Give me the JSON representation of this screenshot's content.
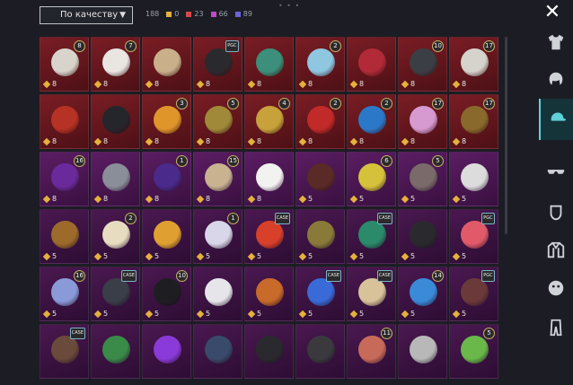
{
  "sort": {
    "label": "По качеству"
  },
  "counts": [
    {
      "value": "188",
      "color": "#9aa0a8"
    },
    {
      "value": "0",
      "color": "#e3b23c"
    },
    {
      "value": "23",
      "color": "#d84848"
    },
    {
      "value": "66",
      "color": "#c04ac8"
    },
    {
      "value": "89",
      "color": "#6b63d8"
    }
  ],
  "close_label": "✕",
  "rows": [
    {
      "rarity": "red",
      "items": [
        {
          "price": "8",
          "badge": "8",
          "art": "#d8d4cc"
        },
        {
          "price": "8",
          "badge": "7",
          "art": "#e9e6e2"
        },
        {
          "price": "8",
          "badge": "",
          "art": "#c9b08a"
        },
        {
          "price": "8",
          "badge": "PGC",
          "art": "#2a2a2e"
        },
        {
          "price": "8",
          "badge": "",
          "art": "#3c8f7a"
        },
        {
          "price": "8",
          "badge": "2",
          "art": "#8fc6e0"
        },
        {
          "price": "8",
          "badge": "",
          "art": "#b22a38"
        },
        {
          "price": "8",
          "badge": "10",
          "art": "#3b3e45"
        },
        {
          "price": "8",
          "badge": "17",
          "art": "#d6d2cc"
        }
      ]
    },
    {
      "rarity": "red",
      "items": [
        {
          "price": "8",
          "badge": "",
          "art": "#b63224"
        },
        {
          "price": "8",
          "badge": "",
          "art": "#24262c"
        },
        {
          "price": "8",
          "badge": "3",
          "art": "#e0952a"
        },
        {
          "price": "8",
          "badge": "5",
          "art": "#a08a3a"
        },
        {
          "price": "8",
          "badge": "4",
          "art": "#c7a23a"
        },
        {
          "price": "8",
          "badge": "2",
          "art": "#c22a2a"
        },
        {
          "price": "8",
          "badge": "2",
          "art": "#2c78c8"
        },
        {
          "price": "8",
          "badge": "17",
          "art": "#d69ad0"
        },
        {
          "price": "8",
          "badge": "17",
          "art": "#8a6a2c"
        }
      ]
    },
    {
      "rarity": "purple",
      "items": [
        {
          "price": "8",
          "badge": "16",
          "art": "#6a2a9c"
        },
        {
          "price": "8",
          "badge": "",
          "art": "#8a8e98"
        },
        {
          "price": "8",
          "badge": "1",
          "art": "#4a2a8a"
        },
        {
          "price": "8",
          "badge": "15",
          "art": "#c8b290"
        },
        {
          "price": "8",
          "badge": "",
          "art": "#f2f2f0"
        },
        {
          "price": "5",
          "badge": "",
          "art": "#5a2a26"
        },
        {
          "price": "5",
          "badge": "6",
          "art": "#d6c23a"
        },
        {
          "price": "5",
          "badge": "5",
          "art": "#7a6a6a"
        },
        {
          "price": "5",
          "badge": "",
          "art": "#dcdcdc"
        }
      ]
    },
    {
      "rarity": "plum",
      "items": [
        {
          "price": "5",
          "badge": "",
          "art": "#9c6a2a"
        },
        {
          "price": "5",
          "badge": "2",
          "art": "#e8dcc0"
        },
        {
          "price": "5",
          "badge": "",
          "art": "#e0a030"
        },
        {
          "price": "5",
          "badge": "1",
          "art": "#d8d6e8"
        },
        {
          "price": "5",
          "badge": "CASE",
          "art": "#d8402a"
        },
        {
          "price": "5",
          "badge": "",
          "art": "#8a7a3a"
        },
        {
          "price": "5",
          "badge": "CASE",
          "art": "#2a8a6a"
        },
        {
          "price": "5",
          "badge": "",
          "art": "#2a2a2e"
        },
        {
          "price": "5",
          "badge": "PGC",
          "art": "#e05a6a"
        }
      ]
    },
    {
      "rarity": "plum",
      "items": [
        {
          "price": "5",
          "badge": "16",
          "art": "#8a9ad8"
        },
        {
          "price": "5",
          "badge": "CASE",
          "art": "#3a3e48"
        },
        {
          "price": "5",
          "badge": "10",
          "art": "#1e1e22"
        },
        {
          "price": "5",
          "badge": "",
          "art": "#e6e6ea"
        },
        {
          "price": "5",
          "badge": "",
          "art": "#c86a2a"
        },
        {
          "price": "5",
          "badge": "CASE",
          "art": "#3a6ad8"
        },
        {
          "price": "5",
          "badge": "CASE",
          "art": "#d8c29a"
        },
        {
          "price": "5",
          "badge": "14",
          "art": "#3a8ad8"
        },
        {
          "price": "5",
          "badge": "PGC",
          "art": "#6a3a3a"
        }
      ]
    },
    {
      "rarity": "plum",
      "items": [
        {
          "price": "",
          "badge": "CASE",
          "art": "#6a4a3a"
        },
        {
          "price": "",
          "badge": "",
          "art": "#3a8a4a"
        },
        {
          "price": "",
          "badge": "",
          "art": "#8a3ad8"
        },
        {
          "price": "",
          "badge": "",
          "art": "#3a4a6a"
        },
        {
          "price": "",
          "badge": "",
          "art": "#2a2a2e"
        },
        {
          "price": "",
          "badge": "",
          "art": "#3a3a3e"
        },
        {
          "price": "",
          "badge": "11",
          "art": "#c86a5a"
        },
        {
          "price": "",
          "badge": "",
          "art": "#b8b8b8"
        },
        {
          "price": "",
          "badge": "5",
          "art": "#6ab84a"
        }
      ]
    }
  ],
  "sidebar": [
    {
      "name": "outfit-category-icon"
    },
    {
      "name": "hair-category-icon"
    },
    {
      "name": "headwear-category-icon",
      "active": true
    },
    {
      "name": "eyewear-category-icon"
    },
    {
      "name": "mask-category-icon"
    },
    {
      "name": "jacket-category-icon"
    },
    {
      "name": "face-category-icon"
    },
    {
      "name": "pants-category-icon"
    }
  ]
}
